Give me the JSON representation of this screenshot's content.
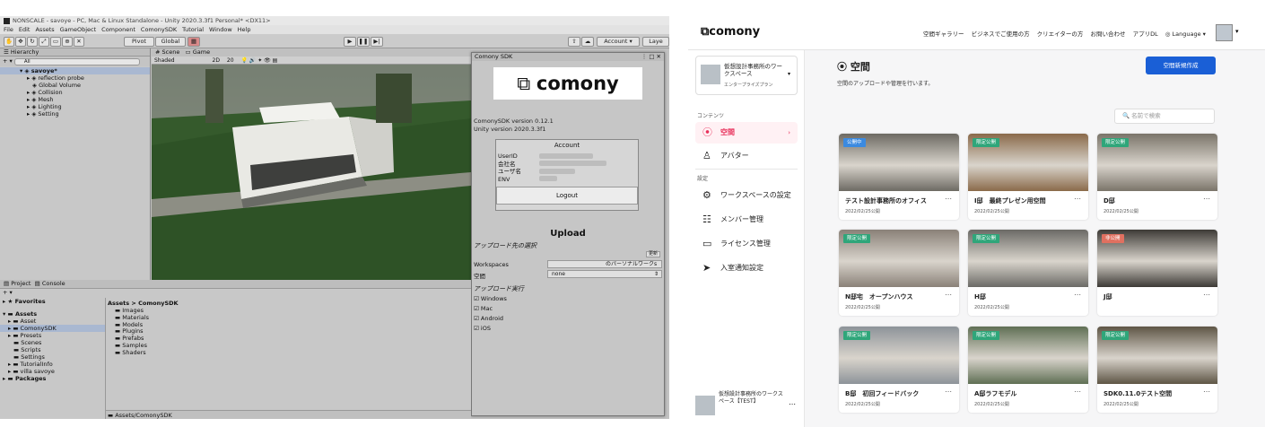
{
  "unity": {
    "title": "NONSCALE - savoye - PC, Mac & Linux Standalone - Unity 2020.3.3f1 Personal* <DX11>",
    "menu": [
      "File",
      "Edit",
      "Assets",
      "GameObject",
      "Component",
      "ComonySDK",
      "Tutorial",
      "Window",
      "Help"
    ],
    "toolbar": {
      "pivot": "Pivot",
      "global": "Global",
      "account": "Account",
      "layers": "Laye"
    },
    "hierarchy": {
      "title": "Hierarchy",
      "search": "All",
      "items": [
        "savoye*",
        "reflection probe",
        "Global Volume",
        "Collision",
        "Mesh",
        "Lighting",
        "Setting"
      ]
    },
    "scene": {
      "tab_scene": "Scene",
      "tab_game": "Game",
      "shading": "Shaded",
      "mode": "2D",
      "zoom": "20"
    },
    "sdk": {
      "title": "Comony SDK",
      "logo": "comony",
      "version": "ComonySDK version 0.12.1",
      "unity_version": "Unity version 2020.3.3f1",
      "account_title": "Account",
      "fields": [
        "UserID",
        "会社名",
        "ユーザ名",
        "ENV"
      ],
      "logout": "Logout",
      "upload_title": "Upload",
      "upload_target": "アップロード先の選択",
      "refresh": "更新",
      "workspaces_label": "Workspaces",
      "workspaces_value": "のパーソナルワークs",
      "space_label": "空間",
      "space_value": "none",
      "exec_title": "アップロード実行",
      "platforms": [
        "Windows",
        "Mac",
        "Android",
        "iOS"
      ]
    },
    "project": {
      "tab_project": "Project",
      "tab_console": "Console",
      "favorites": "Favorites",
      "tree": [
        "Assets",
        "Asset",
        "ComonySDK",
        "Presets",
        "Scenes",
        "Scripts",
        "Settings",
        "TutorialInfo",
        "villa savoye",
        "Packages"
      ],
      "breadcrumb": "Assets > ComonySDK",
      "folders": [
        "Images",
        "Materials",
        "Models",
        "Plugins",
        "Prefabs",
        "Samples",
        "Shaders"
      ],
      "footer_path": "Assets/ComonySDK"
    }
  },
  "comony": {
    "logo": "comony",
    "nav": [
      "空間ギャラリー",
      "ビジネスでご使用の方",
      "クリエイターの方",
      "お問い合わせ",
      "アプリDL",
      "Language"
    ],
    "workspace": {
      "name": "仮想設計事務所のワークスペース",
      "plan": "エンタープライズプラン"
    },
    "sidebar": {
      "section_content": "コンテンツ",
      "items_content": [
        "空間",
        "アバター"
      ],
      "section_settings": "設定",
      "items_settings": [
        "ワークスペースの設定",
        "メンバー管理",
        "ライセンス管理",
        "入室通知設定"
      ],
      "bottom_workspace": "仮想設計事務所のワークスペース【TEST】"
    },
    "main": {
      "title": "空間",
      "subtitle": "空間のアップロードや管理を行います。",
      "create_button": "空間新規作成",
      "search_placeholder": "名前で検索",
      "cards": [
        {
          "badge": "公開中",
          "title": "テスト設計事務所のオフィス",
          "date": "2022/02/25公開",
          "badge_color": "#3b8ae0"
        },
        {
          "badge": "限定公開",
          "title": "I邸　最終プレゼン用空間",
          "date": "2022/02/25公開",
          "badge_color": "#2fa67a"
        },
        {
          "badge": "限定公開",
          "title": "D邸",
          "date": "2022/02/25公開",
          "badge_color": "#2fa67a"
        },
        {
          "badge": "限定公開",
          "title": "N邸宅　オープンハウス",
          "date": "2022/02/25公開",
          "badge_color": "#2fa67a"
        },
        {
          "badge": "限定公開",
          "title": "H邸",
          "date": "2022/02/25公開",
          "badge_color": "#2fa67a"
        },
        {
          "badge": "非公開",
          "title": "J邸",
          "date": "",
          "badge_color": "#e07060"
        },
        {
          "badge": "限定公開",
          "title": "B邸　初回フィードバック",
          "date": "2022/02/25公開",
          "badge_color": "#2fa67a"
        },
        {
          "badge": "限定公開",
          "title": "A邸ラフモデル",
          "date": "2022/02/25公開",
          "badge_color": "#2fa67a"
        },
        {
          "badge": "限定公開",
          "title": "SDK0.11.0テスト空間",
          "date": "2022/02/25公開",
          "badge_color": "#2fa67a"
        }
      ]
    },
    "accent": "#1a5fd6"
  }
}
